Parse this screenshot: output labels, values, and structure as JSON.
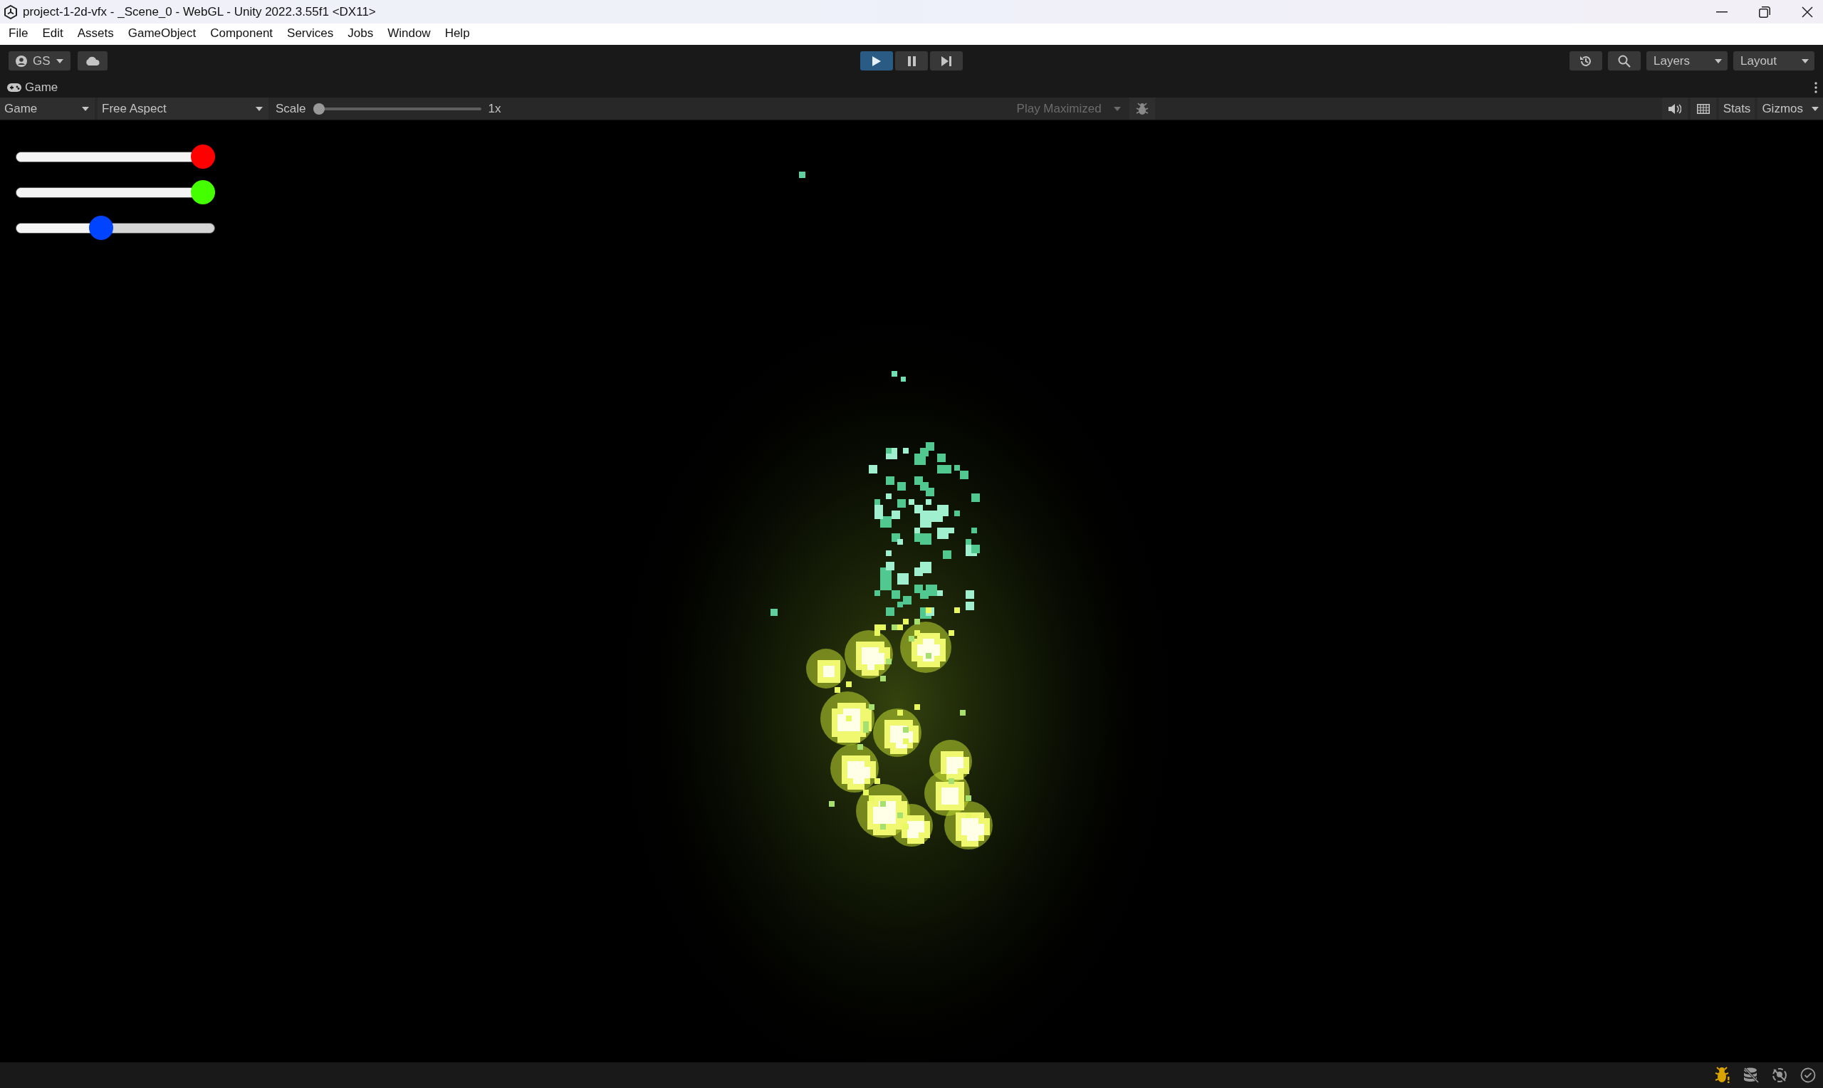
{
  "window": {
    "title": "project-1-2d-vfx - _Scene_0 - WebGL - Unity 2022.3.55f1 <DX11>"
  },
  "menu": [
    "File",
    "Edit",
    "Assets",
    "GameObject",
    "Component",
    "Services",
    "Jobs",
    "Window",
    "Help"
  ],
  "toolbar": {
    "account": "GS",
    "playing": true,
    "paused": false,
    "layers": "Layers",
    "layout": "Layout"
  },
  "panel": {
    "tab": "Game",
    "display": "Game",
    "aspect": "Free Aspect",
    "scale_label": "Scale",
    "scale": {
      "level": 0,
      "reading": "1x"
    },
    "play_maximized": {
      "label": "Play Maximized",
      "disabled": true
    },
    "stats": "Stats",
    "gizmos": "Gizmos"
  },
  "sliders": [
    {
      "color": "#ff0000",
      "level": 1
    },
    {
      "color": "#44ff00",
      "level": 1
    },
    {
      "color": "#0044ff",
      "level": 0.42
    }
  ]
}
